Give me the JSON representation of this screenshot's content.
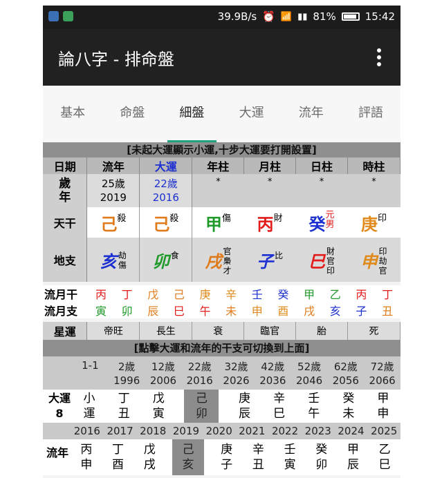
{
  "statusbar": {
    "speed": "39.9B/s",
    "battery": "81%",
    "time": "15:42"
  },
  "appbar": {
    "title": "論八字 - 排命盤"
  },
  "tabs": [
    "基本",
    "命盤",
    "細盤",
    "大運",
    "流年",
    "評語"
  ],
  "active_tab": 2,
  "notice1": "[未起大運顯示小運,十步大運要打開設置]",
  "table_header": [
    "日期",
    "流年",
    "大運",
    "年柱",
    "月柱",
    "日柱",
    "時柱"
  ],
  "age_row": {
    "label": "歲年",
    "flow_age": "25歲",
    "flow_year": "2019",
    "dayun_age": "22歲",
    "dayun_year": "2016",
    "stars": [
      "*",
      "*",
      "*",
      "*"
    ]
  },
  "tiangan": {
    "label": "天干",
    "cells": [
      {
        "char": "己",
        "sup": "殺"
      },
      {
        "char": "己",
        "sup": "殺"
      },
      {
        "char": "甲",
        "sup": "傷"
      },
      {
        "char": "丙",
        "sup": "財"
      },
      {
        "char": "癸",
        "sup": "元男"
      },
      {
        "char": "庚",
        "sup": "印"
      }
    ]
  },
  "dizhi": {
    "label": "地支",
    "cells": [
      {
        "char": "亥",
        "sub": [
          "劫",
          "傷"
        ]
      },
      {
        "char": "卯",
        "sub": [
          "食"
        ]
      },
      {
        "char": "戌",
        "sub": [
          "官",
          "梟",
          "才"
        ]
      },
      {
        "char": "子",
        "sub": [
          "比"
        ]
      },
      {
        "char": "巳",
        "sub": [
          "財",
          "官",
          "印"
        ]
      },
      {
        "char": "申",
        "sub": [
          "印",
          "劫",
          "官"
        ]
      }
    ]
  },
  "liuyue_gan": {
    "label": "流月干",
    "chars": [
      "丙",
      "丁",
      "戊",
      "己",
      "庚",
      "辛",
      "壬",
      "癸",
      "甲",
      "乙",
      "丙",
      "丁"
    ]
  },
  "liuyue_zhi": {
    "label": "流月支",
    "chars": [
      "寅",
      "卯",
      "辰",
      "巳",
      "午",
      "未",
      "申",
      "酉",
      "戌",
      "亥",
      "子",
      "丑"
    ]
  },
  "xingyun": {
    "label": "星運",
    "values": [
      "帝旺",
      "長生",
      "衰",
      "臨官",
      "胎",
      "死"
    ]
  },
  "notice2": "[點擊大運和流年的干支可切換到上面]",
  "dayun_ages": [
    "1-1",
    "2歲",
    "12歲",
    "22歲",
    "32歲",
    "42歲",
    "52歲",
    "62歲",
    "72歲"
  ],
  "dayun_years": [
    "",
    "1996",
    "2006",
    "2016",
    "2026",
    "2036",
    "2046",
    "2056",
    "2066"
  ],
  "dayun": {
    "label1": "大運",
    "label2": "8",
    "cells": [
      [
        "小",
        "運"
      ],
      [
        "丁",
        "丑"
      ],
      [
        "戊",
        "寅"
      ],
      [
        "己",
        "卯"
      ],
      [
        "庚",
        "辰"
      ],
      [
        "辛",
        "巳"
      ],
      [
        "壬",
        "午"
      ],
      [
        "癸",
        "未"
      ],
      [
        "甲",
        "申"
      ]
    ]
  },
  "liunian_years": [
    "2016",
    "2017",
    "2018",
    "2019",
    "2020",
    "2021",
    "2022",
    "2023",
    "2024",
    "2025"
  ],
  "liunian": {
    "label": "流年",
    "cells": [
      [
        "丙",
        "申"
      ],
      [
        "丁",
        "酉"
      ],
      [
        "戊",
        "戌"
      ],
      [
        "己",
        "亥"
      ],
      [
        "庚",
        "子"
      ],
      [
        "辛",
        "丑"
      ],
      [
        "壬",
        "寅"
      ],
      [
        "癸",
        "卯"
      ],
      [
        "甲",
        "辰"
      ],
      [
        "乙",
        "巳"
      ]
    ]
  }
}
